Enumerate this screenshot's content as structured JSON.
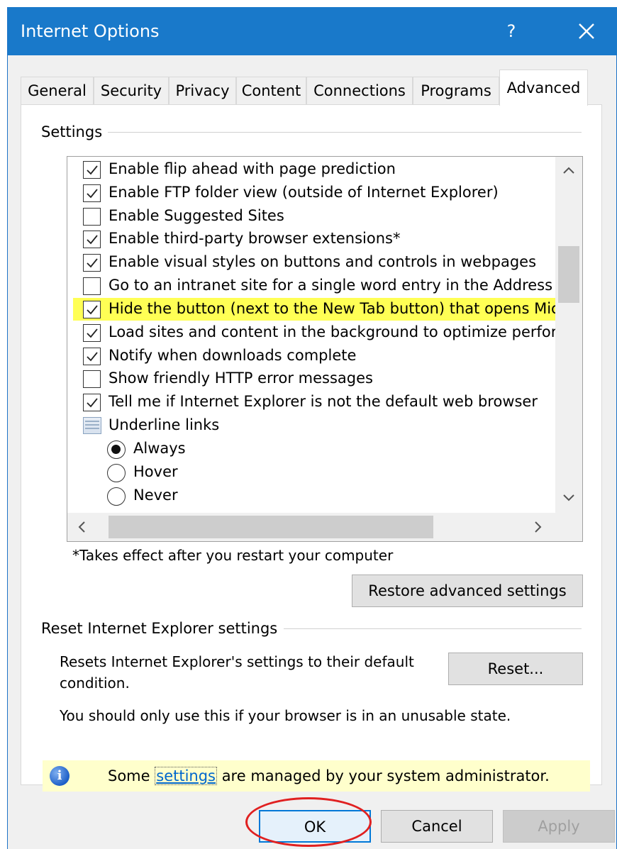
{
  "window": {
    "title": "Internet Options",
    "help_glyph": "?",
    "accent": "#1979ca"
  },
  "tabs": [
    {
      "label": "General"
    },
    {
      "label": "Security"
    },
    {
      "label": "Privacy"
    },
    {
      "label": "Content"
    },
    {
      "label": "Connections"
    },
    {
      "label": "Programs"
    },
    {
      "label": "Advanced",
      "active": true
    }
  ],
  "settings": {
    "group_label": "Settings",
    "items": [
      {
        "type": "checkbox",
        "checked": true,
        "label": "Enable flip ahead with page prediction"
      },
      {
        "type": "checkbox",
        "checked": true,
        "label": "Enable FTP folder view (outside of Internet Explorer)"
      },
      {
        "type": "checkbox",
        "checked": false,
        "label": "Enable Suggested Sites"
      },
      {
        "type": "checkbox",
        "checked": true,
        "label": "Enable third-party browser extensions*"
      },
      {
        "type": "checkbox",
        "checked": true,
        "label": "Enable visual styles on buttons and controls in webpages"
      },
      {
        "type": "checkbox",
        "checked": false,
        "label": "Go to an intranet site for a single word entry in the Address"
      },
      {
        "type": "checkbox",
        "checked": true,
        "label": "Hide the button (next to the New Tab button) that opens Mic",
        "highlighted": true
      },
      {
        "type": "checkbox",
        "checked": true,
        "label": "Load sites and content in the background to optimize perfor"
      },
      {
        "type": "checkbox",
        "checked": true,
        "label": "Notify when downloads complete"
      },
      {
        "type": "checkbox",
        "checked": false,
        "label": "Show friendly HTTP error messages"
      },
      {
        "type": "checkbox",
        "checked": true,
        "label": "Tell me if Internet Explorer is not the default web browser"
      },
      {
        "type": "category",
        "label": "Underline links"
      },
      {
        "type": "radio",
        "checked": true,
        "label": "Always"
      },
      {
        "type": "radio",
        "checked": false,
        "label": "Hover"
      },
      {
        "type": "radio",
        "checked": false,
        "label": "Never"
      }
    ],
    "highlight_color": "#ffff55",
    "restart_note": "*Takes effect after you restart your computer",
    "restore_button": "Restore advanced settings"
  },
  "reset": {
    "group_label": "Reset Internet Explorer settings",
    "description": "Resets Internet Explorer's settings to their default condition.",
    "reset_button": "Reset...",
    "warning": "You should only use this if your browser is in an unusable state."
  },
  "info_bar": {
    "text_before": "Some",
    "link": "settings",
    "text_after": "are managed by your system administrator."
  },
  "footer": {
    "ok": "OK",
    "cancel": "Cancel",
    "apply": "Apply"
  },
  "annotation_color": "#e02020"
}
